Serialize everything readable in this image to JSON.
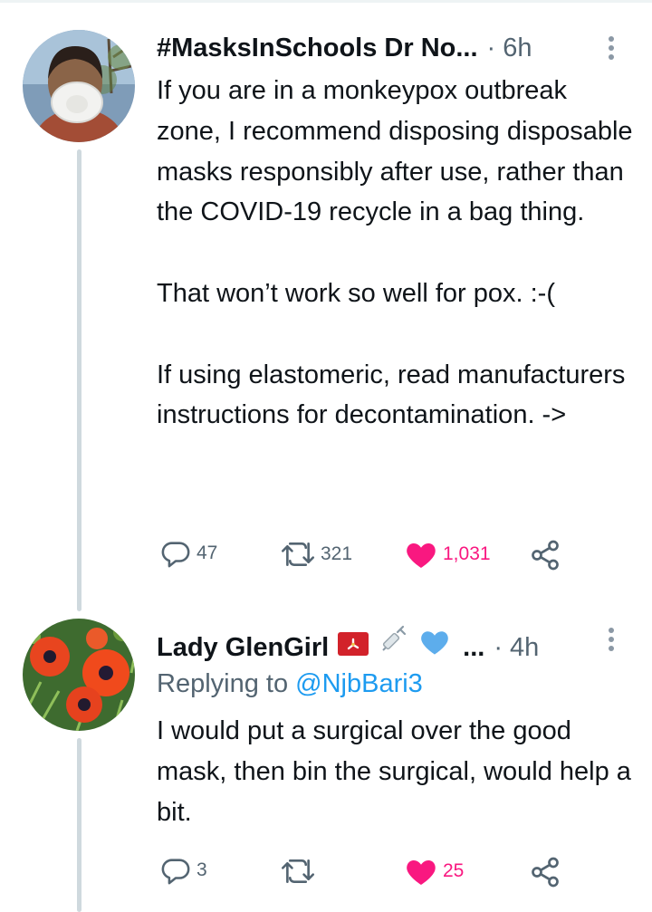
{
  "tweets": [
    {
      "author": "#MasksInSchools Dr No...",
      "time": "· 6h",
      "text": "If you are in a monkeypox outbreak zone, I recommend disposing disposable masks responsibly after use, rather than the COVID-19 recycle in a bag thing.\n\nThat won’t work so well for pox. :-(\n\nIf using elastomeric, read manufacturers instructions for decontamination. ->",
      "replies": "47",
      "retweets": "321",
      "likes": "1,031",
      "liked": true
    },
    {
      "author": "Lady GlenGirl",
      "author_suffix": "...",
      "time": "· 4h",
      "reply_prefix": "Replying to",
      "reply_handle": "@NjbBari3",
      "text": "I would put a surgical over the good mask, then bin the surgical, would help a bit.",
      "replies": "3",
      "retweets": "",
      "likes": "25",
      "liked": true
    }
  ],
  "icons": {
    "reply": "reply-icon",
    "retweet": "retweet-icon",
    "like": "heart-icon",
    "share": "share-icon",
    "more": "more-vertical-icon",
    "flag": "isle-of-man-flag-icon",
    "syringe": "syringe-icon",
    "heart_badge": "blue-heart-icon"
  },
  "colors": {
    "text": "#0f1419",
    "secondary": "#536471",
    "link": "#1d9bf0",
    "like": "#f91880",
    "thread_line": "#cfd9de"
  }
}
